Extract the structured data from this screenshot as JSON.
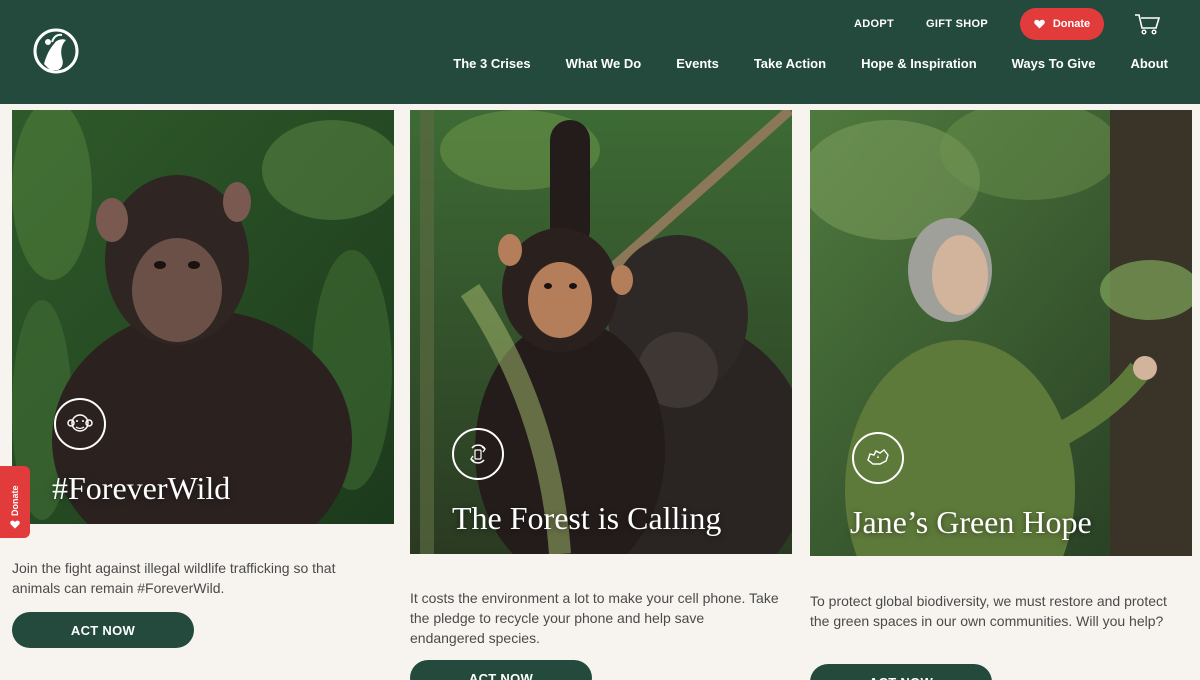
{
  "header": {
    "logo_icon": "jane-goodall-logo-icon",
    "utility": {
      "adopt": "ADOPT",
      "gift_shop": "GIFT SHOP",
      "donate": "Donate",
      "cart_icon": "shopping-cart-icon"
    },
    "nav": [
      {
        "label": "The 3 Crises"
      },
      {
        "label": "What We Do"
      },
      {
        "label": "Events"
      },
      {
        "label": "Take Action"
      },
      {
        "label": "Hope & Inspiration"
      },
      {
        "label": "Ways To Give"
      },
      {
        "label": "About"
      }
    ]
  },
  "cards": [
    {
      "icon": "chimpanzee-face-icon",
      "title": "#ForeverWild",
      "description": "Join the fight against illegal wildlife trafficking so that animals can remain #ForeverWild.",
      "button": "ACT NOW"
    },
    {
      "icon": "recycle-phone-icon",
      "title": "The Forest is Calling",
      "description": "It costs the environment a lot to make your cell phone. Take the pledge to recycle your phone and help save endangered species.",
      "button": "ACT NOW"
    },
    {
      "icon": "canada-map-icon",
      "title": "Jane’s Green Hope",
      "description": "To protect global biodiversity, we must restore and protect the green spaces in our own communities. Will you help?",
      "button": "ACT NOW"
    }
  ],
  "side_tab": {
    "label": "Donate"
  },
  "colors": {
    "header": "#244a3d",
    "donate": "#e23b3b",
    "background": "#f7f4ef",
    "button": "#244a3d"
  }
}
